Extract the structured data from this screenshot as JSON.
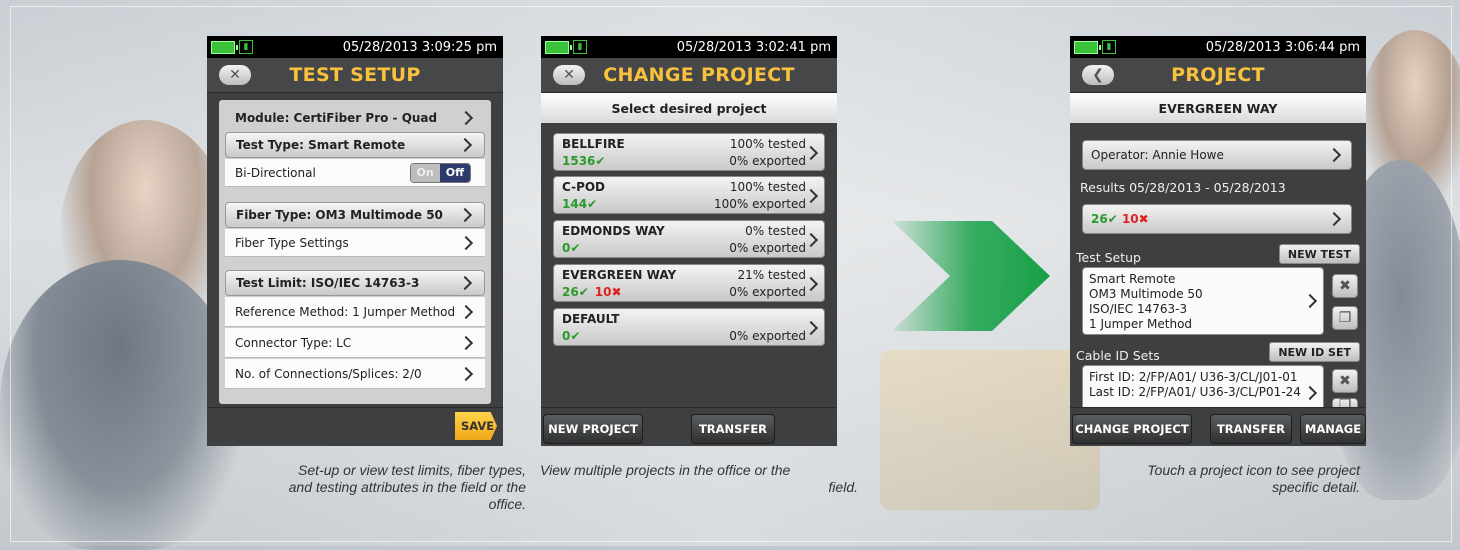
{
  "panel_test_setup": {
    "status_time": "05/28/2013 3:09:25 pm",
    "title": "TEST SETUP",
    "module": "Module: CertiFiber Pro - Quad",
    "test_type": "Test Type: Smart Remote",
    "bidirectional_label": "Bi-Directional",
    "toggle_on": "On",
    "toggle_off": "Off",
    "fiber_type": "Fiber Type: OM3 Multimode 50",
    "fiber_type_settings": "Fiber Type Settings",
    "test_limit": "Test Limit: ISO/IEC 14763-3",
    "reference_method": "Reference Method: 1 Jumper Method",
    "connector_type": "Connector Type: LC",
    "connections": "No. of Connections/Splices: 2/0",
    "save_label": "SAVE"
  },
  "panel_change_project": {
    "status_time": "05/28/2013 3:02:41 pm",
    "title": "CHANGE PROJECT",
    "subheading": "Select desired project",
    "projects": [
      {
        "name": "BELLFIRE",
        "passed": "1536",
        "failed": "",
        "tested": "100% tested",
        "exported": "0% exported"
      },
      {
        "name": "C-POD",
        "passed": "144",
        "failed": "",
        "tested": "100% tested",
        "exported": "100% exported"
      },
      {
        "name": "EDMONDS WAY",
        "passed": "0",
        "failed": "",
        "tested": "0% tested",
        "exported": "0% exported"
      },
      {
        "name": "EVERGREEN WAY",
        "passed": "26",
        "failed": "10",
        "tested": "21% tested",
        "exported": "0% exported"
      },
      {
        "name": "DEFAULT",
        "passed": "0",
        "failed": "",
        "tested": "",
        "exported": "0% exported"
      }
    ],
    "new_project_label": "NEW PROJECT",
    "transfer_label": "TRANSFER"
  },
  "panel_project": {
    "status_time": "05/28/2013 3:06:44 pm",
    "title": "PROJECT",
    "subheading": "EVERGREEN WAY",
    "operator": "Operator: Annie Howe",
    "results_range": "Results 05/28/2013 - 05/28/2013",
    "passed": "26",
    "failed": "10",
    "test_setup_label": "Test Setup",
    "new_test_label": "NEW TEST",
    "setup_lines": [
      "Smart Remote",
      "OM3 Multimode 50",
      "ISO/IEC 14763-3",
      "1 Jumper Method"
    ],
    "cable_id_label": "Cable ID Sets",
    "new_id_set_label": "NEW ID SET",
    "first_id": "First ID: 2/FP/A01/ U36-3/CL/J01-01",
    "last_id": "Last ID: 2/FP/A01/ U36-3/CL/P01-24",
    "change_project_label": "CHANGE PROJECT",
    "transfer_label": "TRANSFER",
    "manage_label": "MANAGE"
  },
  "captions": {
    "test_setup": [
      "Set-up or view test limits, fiber types,",
      "and testing attributes in the field or the",
      "office."
    ],
    "change_project": [
      "View multiple projects in the office or the",
      "field."
    ],
    "project": [
      "Touch a project icon to see project",
      "specific detail."
    ]
  },
  "colors": {
    "accent_title": "#f9c23c",
    "pass_green": "#2a9a2a",
    "fail_red": "#d22222",
    "arrow_green": "#1aa24a",
    "toggle_off": "#2c3a6c"
  }
}
